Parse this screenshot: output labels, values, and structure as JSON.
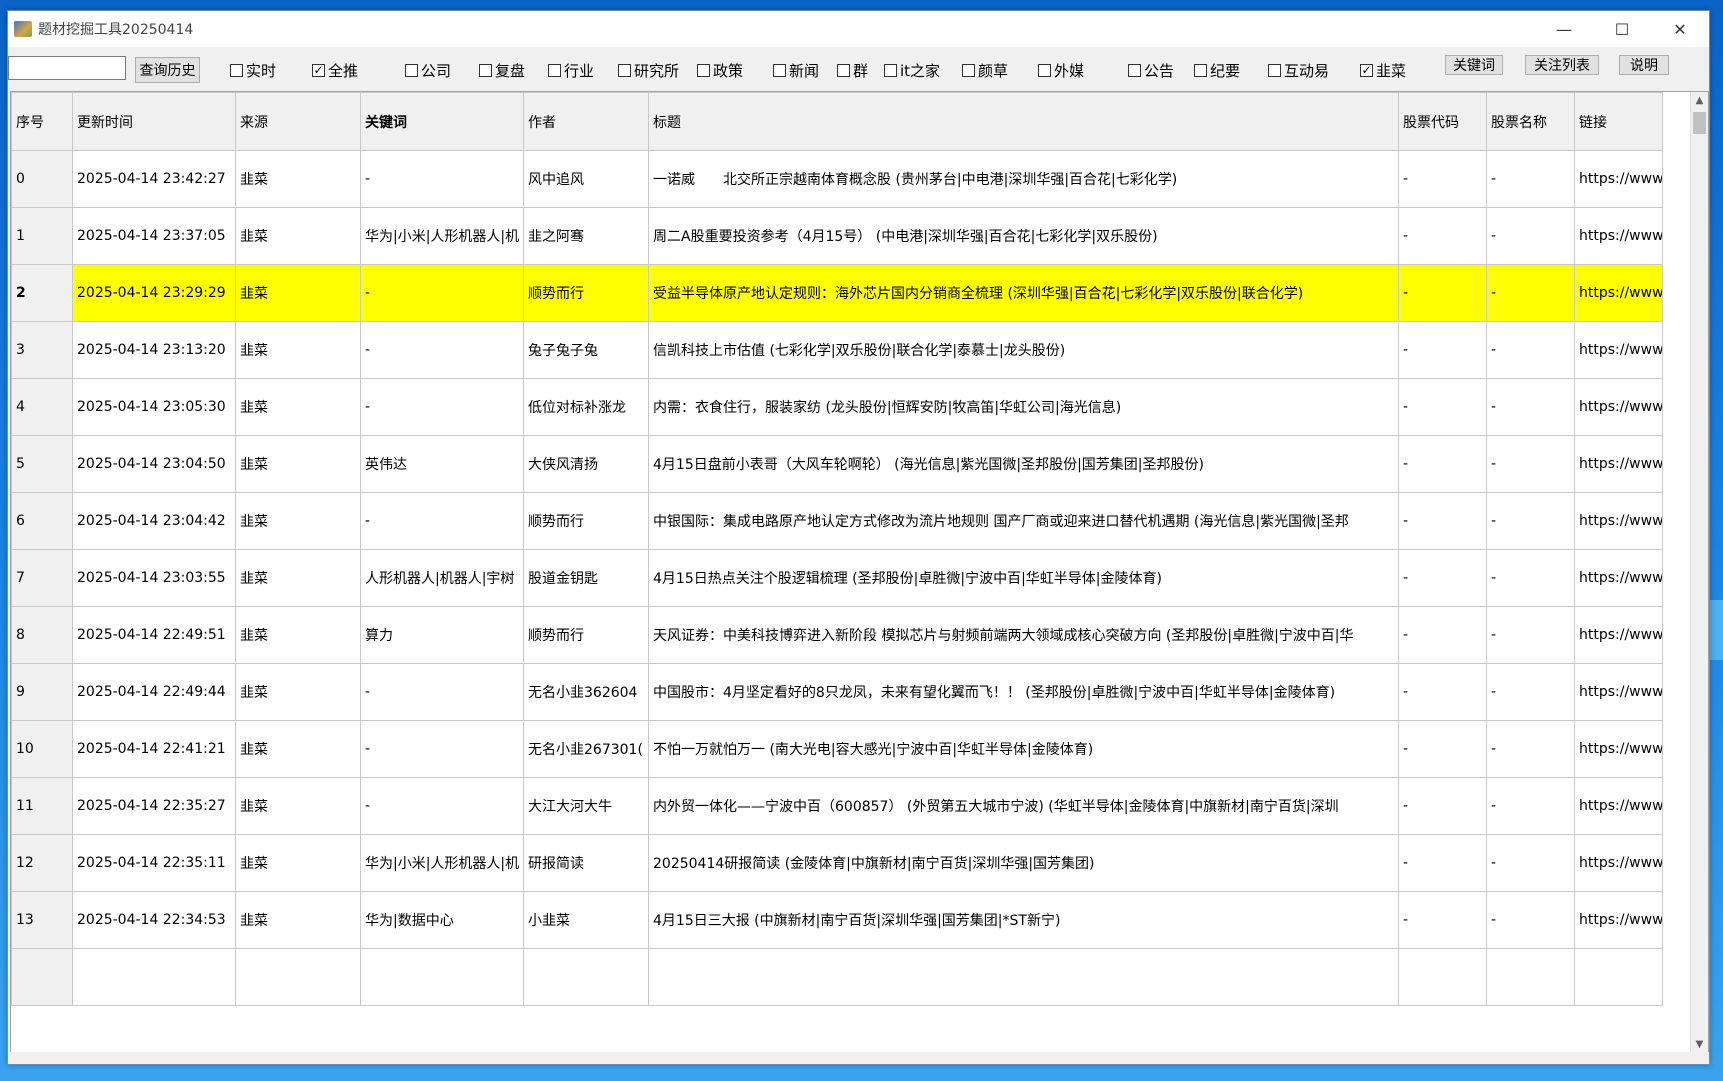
{
  "window": {
    "title": "题材挖掘工具20250414"
  },
  "toolbar": {
    "search_value": "",
    "history_button": "查询历史",
    "checkboxes": [
      {
        "label": "实时",
        "checked": false
      },
      {
        "label": "全推",
        "checked": true
      },
      {
        "label": "公司",
        "checked": false
      },
      {
        "label": "复盘",
        "checked": false
      },
      {
        "label": "行业",
        "checked": false
      },
      {
        "label": "研究所",
        "checked": false
      },
      {
        "label": "政策",
        "checked": false
      },
      {
        "label": "新闻",
        "checked": false
      },
      {
        "label": "群",
        "checked": false
      },
      {
        "label": "it之家",
        "checked": false
      },
      {
        "label": "颜草",
        "checked": false
      },
      {
        "label": "外媒",
        "checked": false
      },
      {
        "label": "公告",
        "checked": false
      },
      {
        "label": "纪要",
        "checked": false
      },
      {
        "label": "互动易",
        "checked": false
      },
      {
        "label": "韭菜",
        "checked": true
      }
    ],
    "keyword_button": "关键词",
    "watchlist_button": "关注列表",
    "help_button": "说明"
  },
  "table": {
    "headers": [
      "序号",
      "更新时间",
      "来源",
      "关键词",
      "作者",
      "标题",
      "股票代码",
      "股票名称",
      "链接"
    ],
    "selected_row": 2,
    "rows": [
      [
        "0",
        "2025-04-14 23:42:27",
        "韭菜",
        "-",
        "风中追风",
        "一诺威　　北交所正宗越南体育概念股 (贵州茅台|中电港|深圳华强|百合花|七彩化学)",
        "-",
        "-",
        "https://www"
      ],
      [
        "1",
        "2025-04-14 23:37:05",
        "韭菜",
        "华为|小米|人形机器人|机",
        "韭之阿骞",
        "周二A股重要投资参考（4月15号） (中电港|深圳华强|百合花|七彩化学|双乐股份)",
        "-",
        "-",
        "https://www"
      ],
      [
        "2",
        "2025-04-14 23:29:29",
        "韭菜",
        "-",
        "顺势而行",
        "受益半导体原产地认定规则：海外芯片国内分销商全梳理 (深圳华强|百合花|七彩化学|双乐股份|联合化学)",
        "-",
        "-",
        "https://www"
      ],
      [
        "3",
        "2025-04-14 23:13:20",
        "韭菜",
        "-",
        "兔子兔子兔",
        "信凯科技上市估值 (七彩化学|双乐股份|联合化学|泰慕士|龙头股份)",
        "-",
        "-",
        "https://www"
      ],
      [
        "4",
        "2025-04-14 23:05:30",
        "韭菜",
        "-",
        "低位对标补涨龙",
        "内需：衣食住行，服装家纺 (龙头股份|恒辉安防|牧高笛|华虹公司|海光信息)",
        "-",
        "-",
        "https://www"
      ],
      [
        "5",
        "2025-04-14 23:04:50",
        "韭菜",
        "英伟达",
        "大侠风清扬",
        "4月15日盘前小表哥（大风车轮啊轮） (海光信息|紫光国微|圣邦股份|国芳集团|圣邦股份)",
        "-",
        "-",
        "https://www"
      ],
      [
        "6",
        "2025-04-14 23:04:42",
        "韭菜",
        "-",
        "顺势而行",
        "中银国际：集成电路原产地认定方式修改为流片地规则 国产厂商或迎来进口替代机遇期 (海光信息|紫光国微|圣邦",
        "-",
        "-",
        "https://www"
      ],
      [
        "7",
        "2025-04-14 23:03:55",
        "韭菜",
        "人形机器人|机器人|宇树",
        "股道金钥匙",
        "4月15日热点关注个股逻辑梳理 (圣邦股份|卓胜微|宁波中百|华虹半导体|金陵体育)",
        "-",
        "-",
        "https://www"
      ],
      [
        "8",
        "2025-04-14 22:49:51",
        "韭菜",
        "算力",
        "顺势而行",
        "天风证券：中美科技博弈进入新阶段 模拟芯片与射频前端两大领域成核心突破方向 (圣邦股份|卓胜微|宁波中百|华",
        "-",
        "-",
        "https://www"
      ],
      [
        "9",
        "2025-04-14 22:49:44",
        "韭菜",
        "-",
        "无名小韭362604",
        "中国股市：4月坚定看好的8只龙凤，未来有望化翼而飞！！ (圣邦股份|卓胜微|宁波中百|华虹半导体|金陵体育)",
        "-",
        "-",
        "https://www"
      ],
      [
        "10",
        "2025-04-14 22:41:21",
        "韭菜",
        "-",
        "无名小韭267301(",
        "不怕一万就怕万一 (南大光电|容大感光|宁波中百|华虹半导体|金陵体育)",
        "-",
        "-",
        "https://www"
      ],
      [
        "11",
        "2025-04-14 22:35:27",
        "韭菜",
        "-",
        "大江大河大牛",
        "内外贸一体化——宁波中百（600857） (外贸第五大城市宁波) (华虹半导体|金陵体育|中旗新材|南宁百货|深圳",
        "-",
        "-",
        "https://www"
      ],
      [
        "12",
        "2025-04-14 22:35:11",
        "韭菜",
        "华为|小米|人形机器人|机",
        "研报简读",
        "20250414研报简读 (金陵体育|中旗新材|南宁百货|深圳华强|国芳集团)",
        "-",
        "-",
        "https://www"
      ],
      [
        "13",
        "2025-04-14 22:34:53",
        "韭菜",
        "华为|数据中心",
        "小韭菜",
        "4月15日三大报 (中旗新材|南宁百货|深圳华强|国芳集团|*ST新宁)",
        "-",
        "-",
        "https://www"
      ],
      [
        "",
        "",
        "",
        "",
        "",
        "",
        "",
        "",
        ""
      ]
    ]
  }
}
